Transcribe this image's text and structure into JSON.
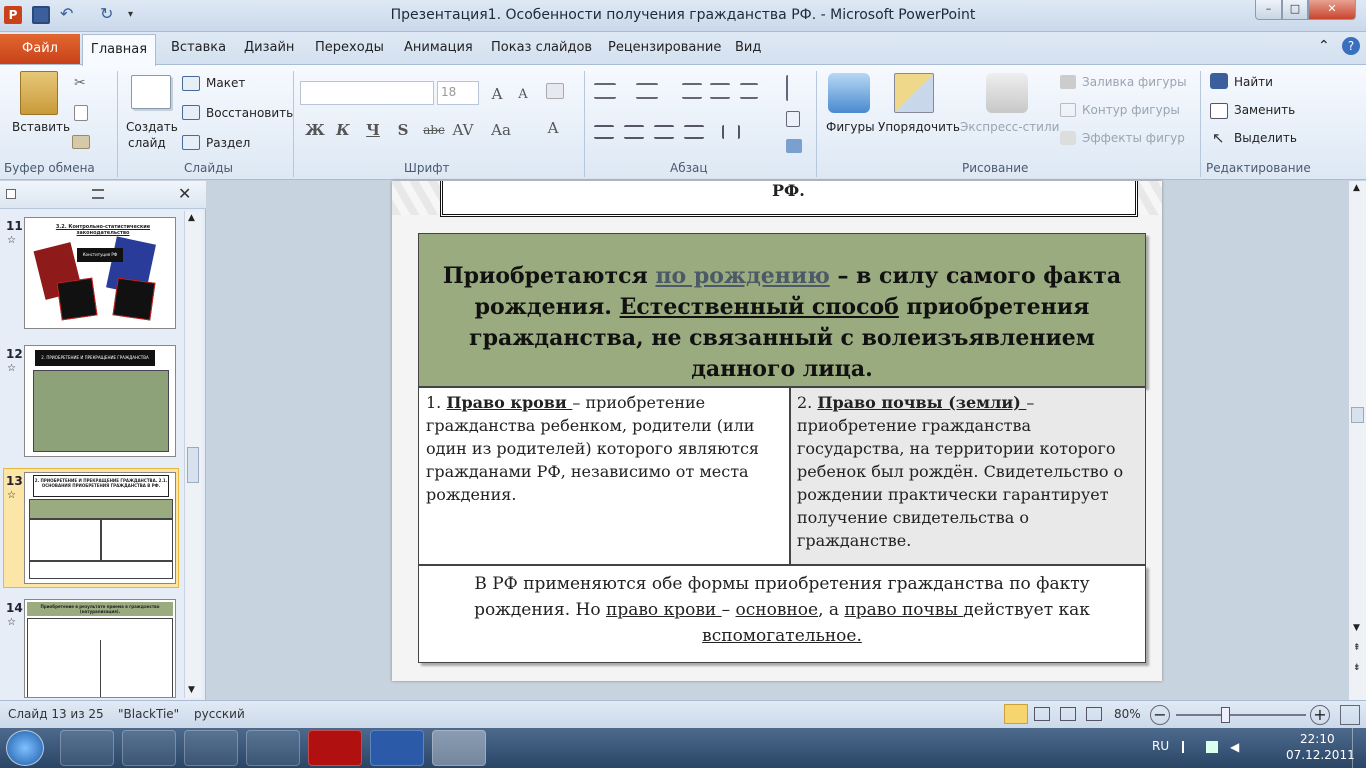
{
  "window": {
    "title": "Презентация1. Особенности получения гражданства РФ.  -  Microsoft PowerPoint",
    "controls": [
      "–",
      "□",
      "✕"
    ]
  },
  "menu": {
    "file": "Файл",
    "tabs": [
      "Главная",
      "Вставка",
      "Дизайн",
      "Переходы",
      "Анимация",
      "Показ слайдов",
      "Рецензирование",
      "Вид"
    ]
  },
  "ribbon": {
    "clipboard": {
      "paste": "Вставить",
      "label": "Буфер обмена"
    },
    "slides": {
      "new_slide_1": "Создать",
      "new_slide_2": "слайд",
      "layout": "Макет",
      "reset": "Восстановить",
      "section": "Раздел",
      "label": "Слайды"
    },
    "font": {
      "font_size": "18",
      "bold": "Ж",
      "italic": "К",
      "underline": "Ч",
      "shadow": "S",
      "strike": "abc",
      "label": "Шрифт"
    },
    "paragraph": {
      "label": "Абзац"
    },
    "drawing": {
      "shapes": "Фигуры",
      "arrange": "Упорядочить",
      "quick_styles": "Экспресс-стили",
      "fill": "Заливка фигуры",
      "outline": "Контур фигуры",
      "effects": "Эффекты фигур",
      "label": "Рисование"
    },
    "editing": {
      "find": "Найти",
      "replace": "Заменить",
      "select": "Выделить",
      "label": "Редактирование"
    }
  },
  "thumbnails": [
    {
      "num": "11",
      "caption": "3.2. Контрольно-статистические законодательство",
      "label": "Конституция РФ"
    },
    {
      "num": "12",
      "caption": "2. ПРИОБРЕТЕНИЕ И ПРЕКРАЩЕНИЕ ГРАЖДАНСТВА"
    },
    {
      "num": "13",
      "caption": "2. ПРИОБРЕТЕНИЕ И ПРЕКРАЩЕНИЕ ГРАЖДАНСТВА. 2.1. ОСНОВАНИЯ ПРИОБРЕТЕНИЯ ГРАЖДАНСТВА В РФ."
    },
    {
      "num": "14",
      "caption": "Приобретение в результате приема в гражданство (натурализация)."
    }
  ],
  "slide": {
    "top_text": "РФ.",
    "header": {
      "w1": "Приобретаются ",
      "w2": "по рождению",
      "w3": " – в силу самого факта рождения. ",
      "w4": "Естественный способ",
      "w5": " приобретения гражданства, не связанный с волеизъявлением данного лица."
    },
    "left_cell": {
      "num": "1. ",
      "term": "Право крови ",
      "text": "– приобретение гражданства  ребенком, родители (или один из родителей) которого являются гражданами РФ, независимо от места рождения."
    },
    "right_cell": {
      "num": "2. ",
      "term": "Право почвы (земли) ",
      "text": "– приобретение гражданства государства,  на территории которого ребенок  был рождён. Свидетельство  о рождении практически гарантирует получение  свидетельства о гражданстве."
    },
    "footer": {
      "t1": "В РФ применяются обе  формы приобретения гражданства по факту рождения. Но ",
      "t2": "право крови ",
      "t3": "– ",
      "t4": "основное",
      "t5": ", а ",
      "t6": "право почвы ",
      "t7": "действует как ",
      "t8": "вспомогательное."
    }
  },
  "status": {
    "slide": "Слайд 13 из 25",
    "theme": "\"BlackTie\"",
    "lang": "русский",
    "zoom": "80%"
  },
  "taskbar": {
    "lang": "RU",
    "time": "22:10",
    "date": "07.12.2011"
  },
  "colors": {
    "header_bg": "#9aab80",
    "accent": "#c9421a"
  }
}
